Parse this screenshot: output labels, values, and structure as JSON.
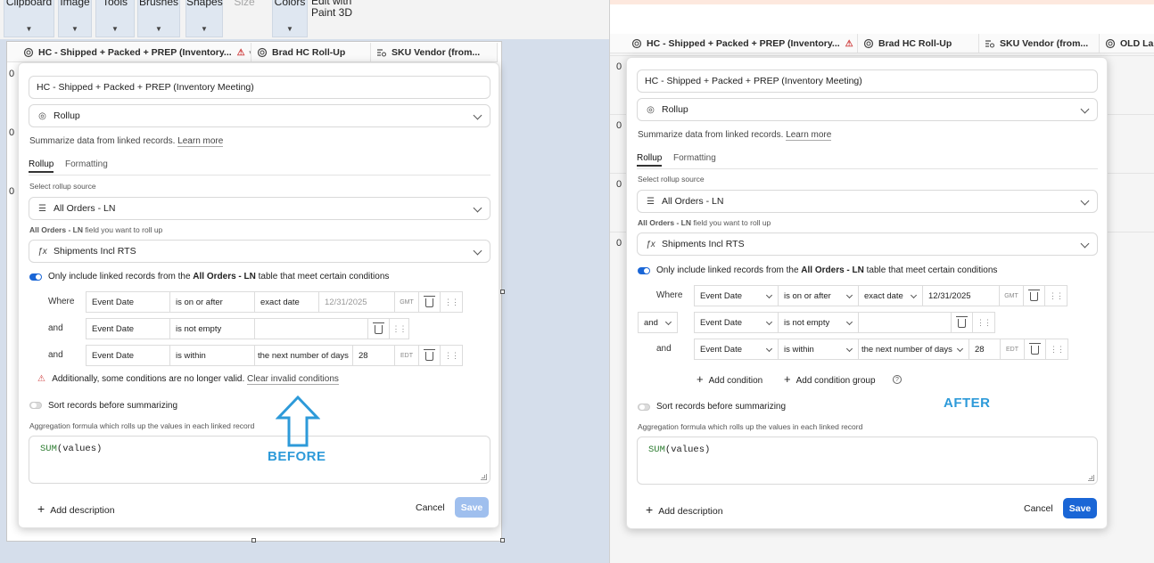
{
  "ribbon": {
    "groups": [
      "Clipboard",
      "Image",
      "Tools",
      "Brushes",
      "Shapes",
      "Size",
      "Colors"
    ],
    "paint3d_line1": "Edit with",
    "paint3d_line2": "Paint 3D"
  },
  "left_grid": {
    "headers": [
      "HC - Shipped + Packed + PREP (Inventory...",
      "Brad HC Roll-Up",
      "SKU Vendor (from..."
    ],
    "row_values": [
      "0",
      "0",
      "0"
    ]
  },
  "right_grid": {
    "headers": [
      "HC - Shipped + Packed + PREP (Inventory...",
      "Brad HC Roll-Up",
      "SKU Vendor (from...",
      "OLD Labo"
    ],
    "row_values": [
      "0",
      "0",
      "0",
      "0"
    ]
  },
  "before": {
    "field_name": "HC - Shipped + Packed + PREP (Inventory Meeting)",
    "field_type": "Rollup",
    "summary_text": "Summarize data from linked records.",
    "learn_more": "Learn more",
    "tabs": [
      "Rollup",
      "Formatting"
    ],
    "source_label": "Select rollup source",
    "source_value": "All Orders - LN",
    "field_label_bold": "All Orders - LN",
    "field_label_rest": " field you want to roll up",
    "field_value": "Shipments Incl RTS",
    "only_include_pre": "Only include linked records from the ",
    "only_include_bold": "All Orders - LN",
    "only_include_post": " table that meet certain conditions",
    "conditions": [
      {
        "conj": "Where",
        "field": "Event Date",
        "op": "is on or after",
        "mode": "exact date",
        "value": "12/31/2025",
        "tz": "GMT"
      },
      {
        "conj": "and",
        "field": "Event Date",
        "op": "is not empty",
        "mode": "",
        "value": "",
        "tz": ""
      },
      {
        "conj": "and",
        "field": "Event Date",
        "op": "is within",
        "mode": "the next number of days",
        "value": "28",
        "tz": "EDT"
      }
    ],
    "invalid_text": "Additionally, some conditions are no longer valid.",
    "clear_invalid": "Clear invalid conditions",
    "sort_label": "Sort records before summarizing",
    "agg_label": "Aggregation formula which rolls up the values in each linked record",
    "formula_fn": "SUM",
    "formula_args": "(values)",
    "add_description": "Add description",
    "cancel": "Cancel",
    "save": "Save",
    "annotation": "BEFORE"
  },
  "after": {
    "field_name": "HC - Shipped + Packed + PREP (Inventory Meeting)",
    "field_type": "Rollup",
    "summary_text": "Summarize data from linked records.",
    "learn_more": "Learn more",
    "tabs": [
      "Rollup",
      "Formatting"
    ],
    "source_label": "Select rollup source",
    "source_value": "All Orders - LN",
    "field_label_bold": "All Orders - LN",
    "field_label_rest": " field you want to roll up",
    "field_value": "Shipments Incl RTS",
    "only_include_pre": "Only include linked records from the ",
    "only_include_bold": "All Orders - LN",
    "only_include_post": " table that meet certain conditions",
    "conditions": [
      {
        "conj": "Where",
        "field": "Event Date",
        "op": "is on or after",
        "mode": "exact date",
        "value": "12/31/2025",
        "tz": "GMT"
      },
      {
        "conj": "and",
        "field": "Event Date",
        "op": "is not empty",
        "mode": "",
        "value": "",
        "tz": ""
      },
      {
        "conj": "and",
        "field": "Event Date",
        "op": "is within",
        "mode": "the next number of days",
        "value": "28",
        "tz": "EDT"
      }
    ],
    "add_condition": "Add condition",
    "add_condition_group": "Add condition group",
    "help": "?",
    "sort_label": "Sort records before summarizing",
    "agg_label": "Aggregation formula which rolls up the values in each linked record",
    "formula_fn": "SUM",
    "formula_args": "(values)",
    "add_description": "Add description",
    "cancel": "Cancel",
    "save": "Save",
    "annotation": "AFTER"
  },
  "colors": {
    "accent": "#1a66d6",
    "save_disabled": "#9fbfee",
    "annotation": "#2d9ad9",
    "warning": "#d04444"
  }
}
